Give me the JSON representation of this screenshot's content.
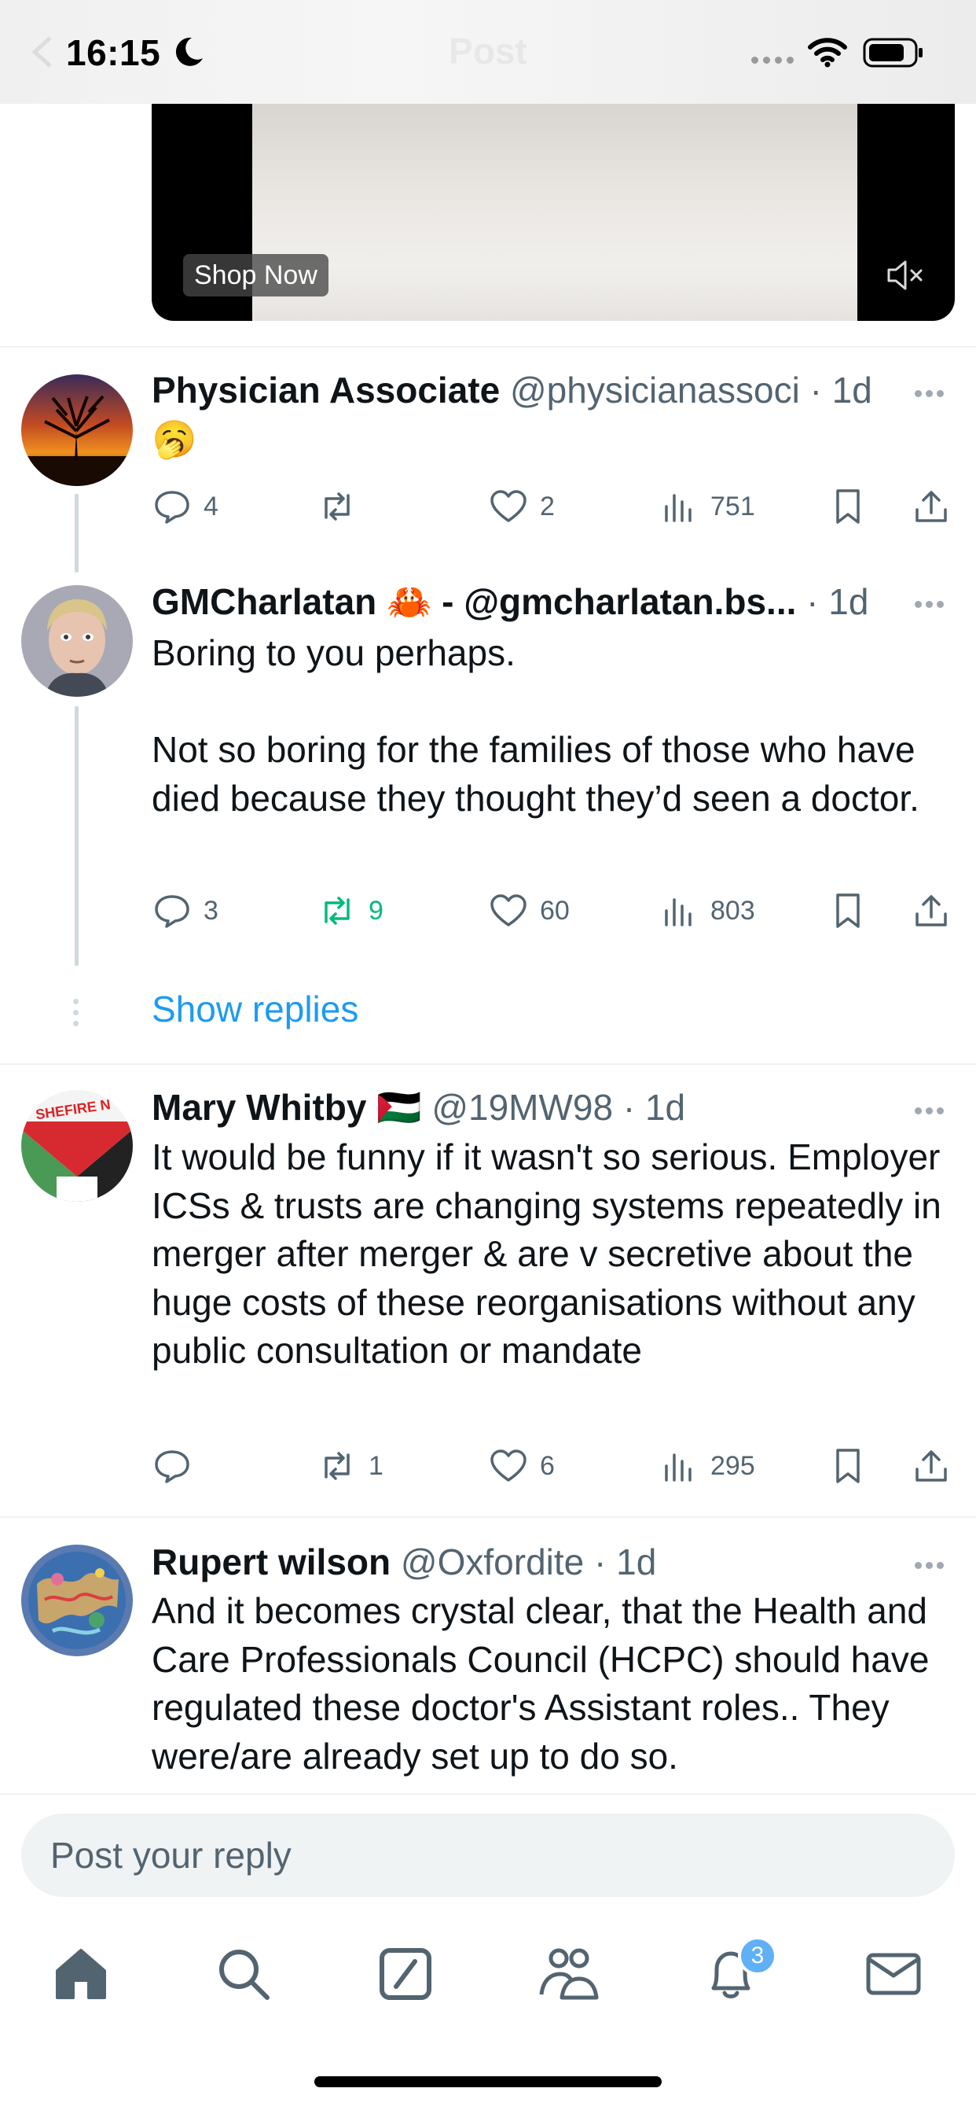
{
  "status_bar": {
    "time": "16:15"
  },
  "header": {
    "title": "Post"
  },
  "media": {
    "shop_now_label": "Shop Now"
  },
  "tweets": [
    {
      "name": "Physician Associate",
      "handle": "@physicianassoci",
      "time": "1d",
      "text": "🥱",
      "replies": "4",
      "retweets": "",
      "likes": "2",
      "views": "751"
    },
    {
      "name": "GMCharlatan 🦀 - @gmcharlatan.bs...",
      "handle": "",
      "time": "1d",
      "text": "Boring to you perhaps.\n\nNot so boring for the families of those who have died because they thought they’d seen a doctor.",
      "replies": "3",
      "retweets": "9",
      "likes": "60",
      "views": "803"
    },
    {
      "name": "Mary Whitby 🇵🇸",
      "handle": "@19MW98",
      "time": "1d",
      "text": "It would be funny if it wasn't so serious. Employer ICSs & trusts are changing systems repeatedly in merger after merger & are v secretive about the huge costs of these reorganisations without any public consultation or mandate",
      "replies": "",
      "retweets": "1",
      "likes": "6",
      "views": "295"
    },
    {
      "name": "Rupert wilson",
      "handle": "@Oxfordite",
      "time": "1d",
      "text": "And it becomes crystal clear, that the Health and Care Professionals Council (HCPC) should have regulated these doctor's Assistant roles.. They were/are already set up to do so."
    }
  ],
  "show_replies_label": "Show replies",
  "avatar_labels": {
    "mary_whitby": "SHEFIRE N"
  },
  "composer": {
    "placeholder": "Post your reply"
  },
  "tabbar": {
    "notifications_badge": "3"
  },
  "colors": {
    "accent": "#1d9bf0",
    "retweet_active": "#00ba7c",
    "muted": "#536471"
  }
}
